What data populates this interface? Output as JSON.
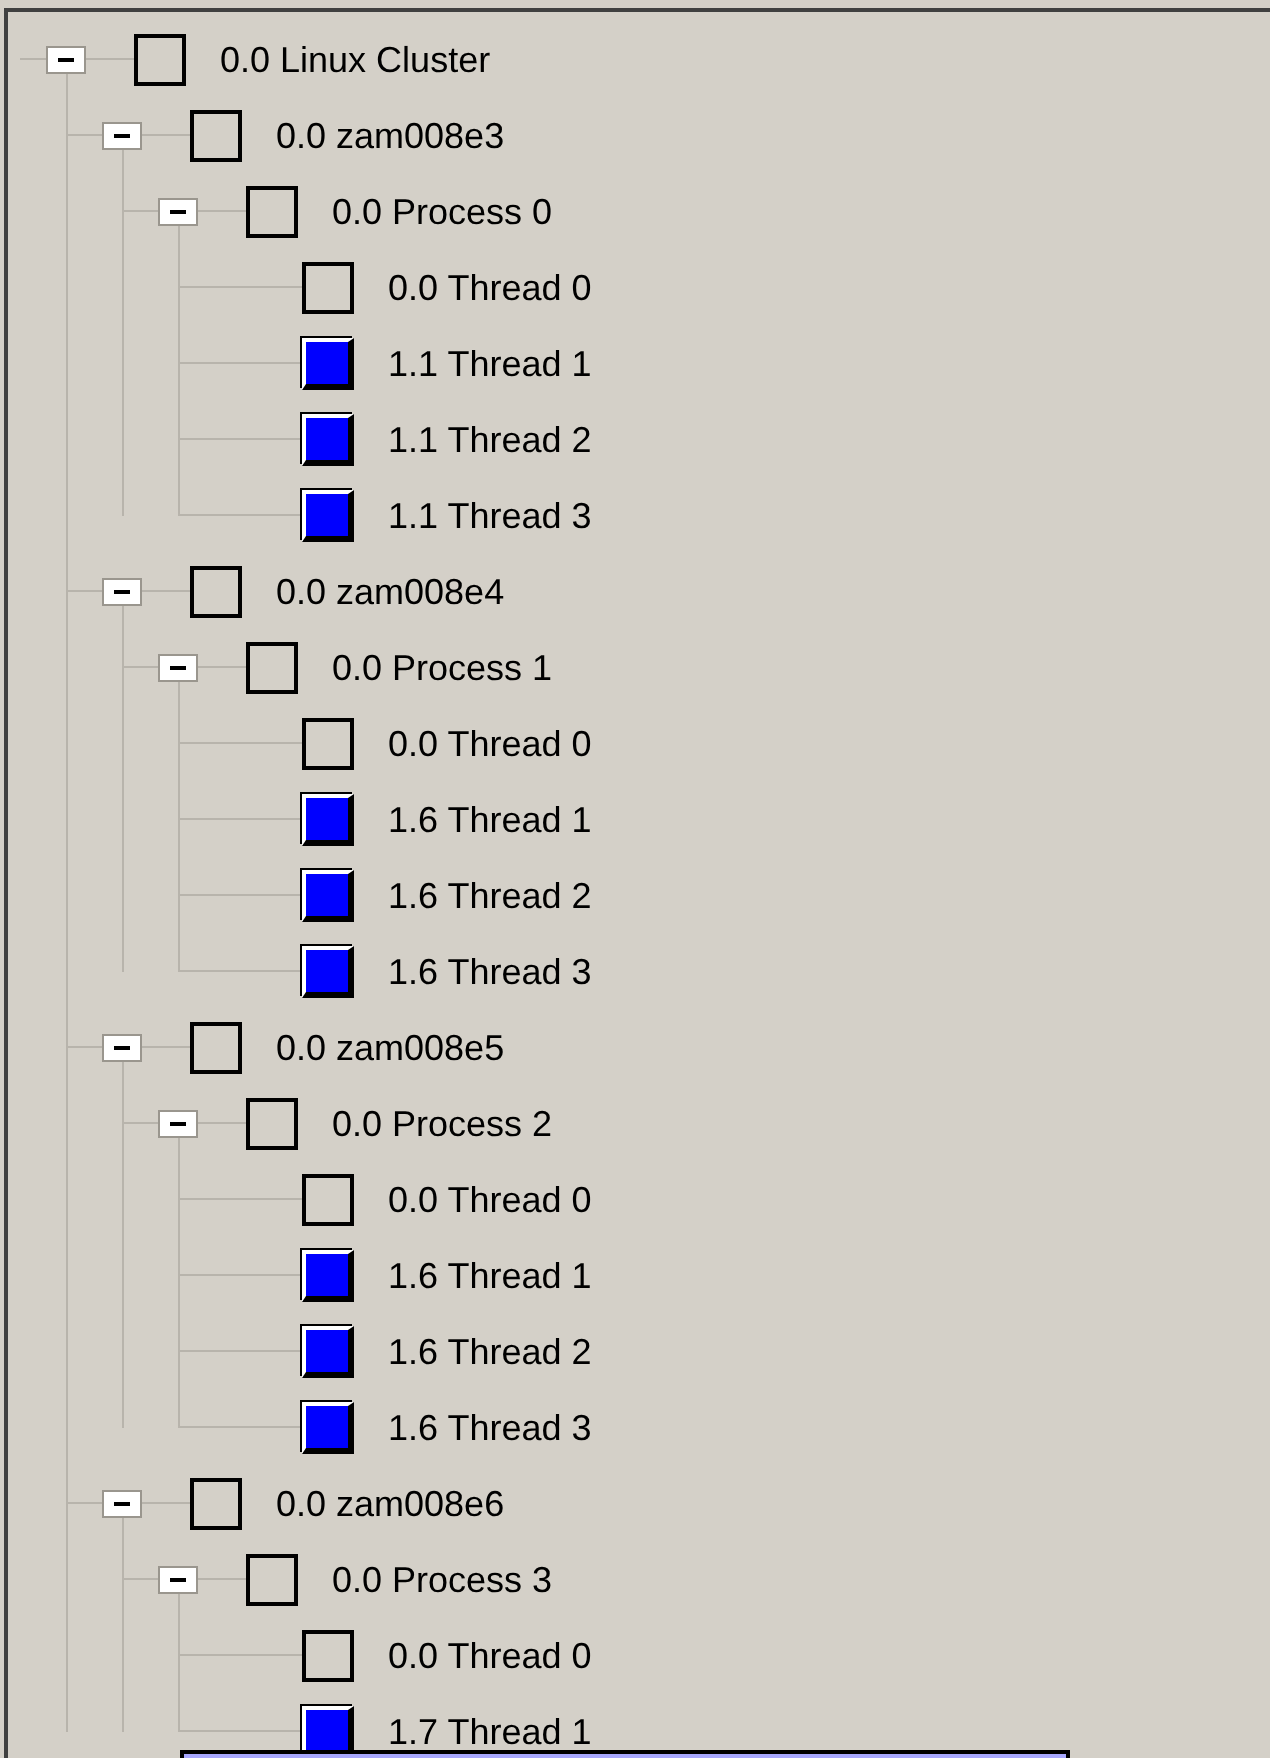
{
  "tree": [
    {
      "label": "0.0 Linux Cluster",
      "expanded": true,
      "children": [
        {
          "label": "0.0 zam008e3",
          "expanded": true,
          "children": [
            {
              "label": "0.0 Process 0",
              "expanded": true,
              "children": [
                {
                  "label": "0.0 Thread 0"
                },
                {
                  "label": "1.1 Thread 1",
                  "color": "#0000ff"
                },
                {
                  "label": "1.1 Thread 2",
                  "color": "#0000ff"
                },
                {
                  "label": "1.1 Thread 3",
                  "color": "#0000ff"
                }
              ]
            }
          ]
        },
        {
          "label": "0.0 zam008e4",
          "expanded": true,
          "children": [
            {
              "label": "0.0 Process 1",
              "expanded": true,
              "children": [
                {
                  "label": "0.0 Thread 0"
                },
                {
                  "label": "1.6 Thread 1",
                  "color": "#0000ff"
                },
                {
                  "label": "1.6 Thread 2",
                  "color": "#0000ff"
                },
                {
                  "label": "1.6 Thread 3",
                  "color": "#0000ff"
                }
              ]
            }
          ]
        },
        {
          "label": "0.0 zam008e5",
          "expanded": true,
          "children": [
            {
              "label": "0.0 Process 2",
              "expanded": true,
              "children": [
                {
                  "label": "0.0 Thread 0"
                },
                {
                  "label": "1.6 Thread 1",
                  "color": "#0000ff"
                },
                {
                  "label": "1.6 Thread 2",
                  "color": "#0000ff"
                },
                {
                  "label": "1.6 Thread 3",
                  "color": "#0000ff"
                }
              ]
            }
          ]
        },
        {
          "label": "0.0 zam008e6",
          "expanded": true,
          "children": [
            {
              "label": "0.0 Process 3",
              "expanded": true,
              "children": [
                {
                  "label": "0.0 Thread 0"
                },
                {
                  "label": "1.7 Thread 1",
                  "color": "#0000ff"
                }
              ]
            }
          ]
        }
      ]
    }
  ]
}
